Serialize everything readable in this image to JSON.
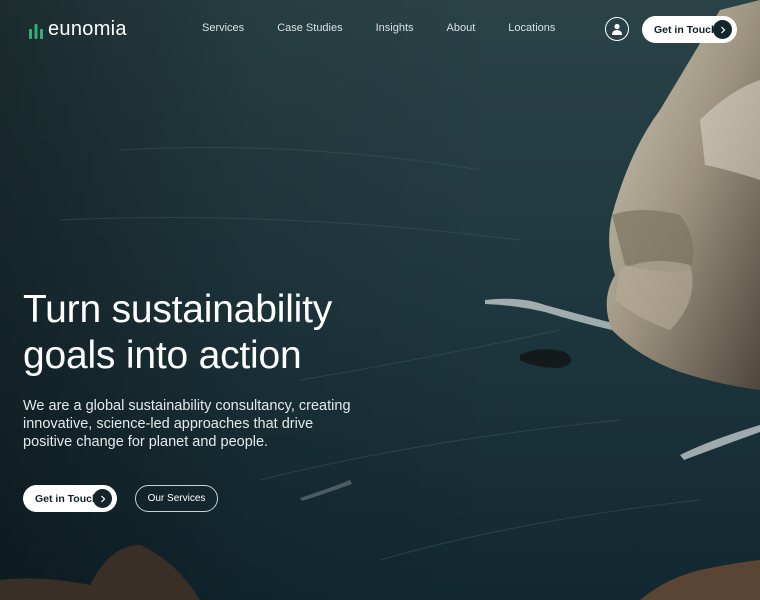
{
  "brand": {
    "name": "eunomia",
    "logo_icon": "leaf-bars-icon",
    "logo_color": "#2fb07a"
  },
  "nav": {
    "links": [
      "Services",
      "Case Studies",
      "Insights",
      "About",
      "Locations"
    ],
    "account_icon": "user-icon",
    "cta_label": "Get in Touch",
    "cta_icon": "chevron-right-icon"
  },
  "hero": {
    "headline_line1": "Turn sustainability",
    "headline_line2": "goals into action",
    "description": "We are a global sustainability consultancy, creating innovative, science-led approaches that drive positive change for planet and people.",
    "primary_button": "Get in Touch",
    "primary_icon": "chevron-right-icon",
    "secondary_button": "Our Services"
  },
  "colors": {
    "dark": "#14252b",
    "sea": "#1d343b",
    "accent": "#2fb07a"
  }
}
